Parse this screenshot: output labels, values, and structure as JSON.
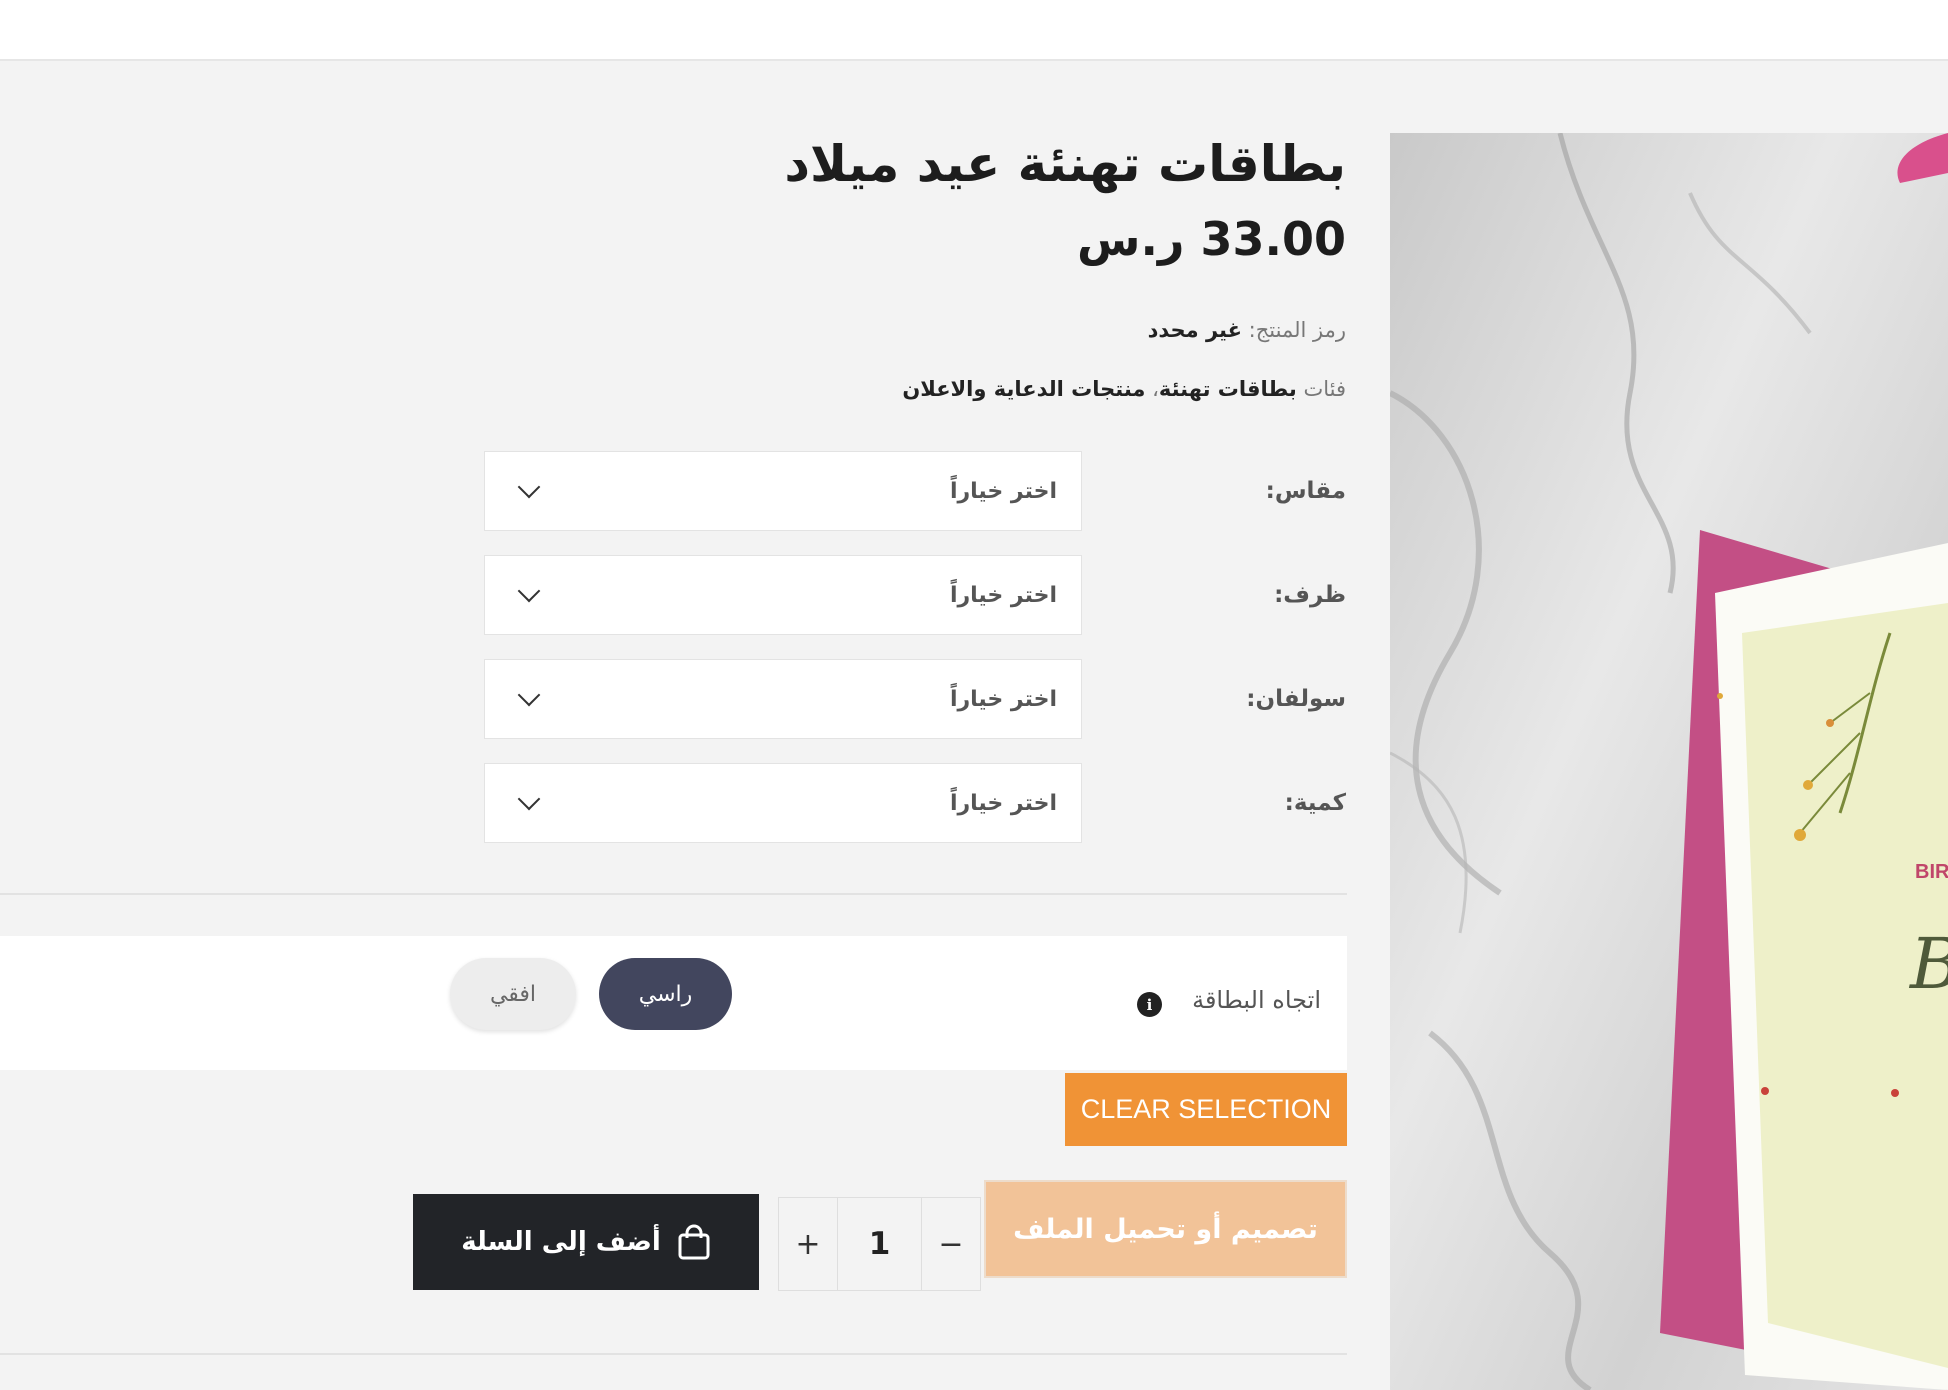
{
  "product": {
    "title": "بطاقات تهنئة عيد ميلاد",
    "price": "33.00 ر.س",
    "sku_label": "رمز المنتج:",
    "sku_value": "غير محدد",
    "categories_label": "فئات",
    "categories": [
      "بطاقات تهنئة",
      "منتجات الدعاية والاعلان"
    ],
    "categories_separator": "،",
    "image_text": "BIRTHDAY"
  },
  "variations": [
    {
      "label": "مقاس:",
      "value": "اختر خياراً"
    },
    {
      "label": "ظرف:",
      "value": "اختر خياراً"
    },
    {
      "label": "سولفان:",
      "value": "اختر خياراً"
    },
    {
      "label": "كمية:",
      "value": "اختر خياراً"
    }
  ],
  "orientation": {
    "label": "اتجاه البطاقة",
    "info_icon": "info-icon",
    "options": [
      "راسي",
      "افقي"
    ],
    "selected": "راسي"
  },
  "actions": {
    "clear_selection": "CLEAR SELECTION",
    "design_upload": "تصميم أو تحميل الملف",
    "add_to_cart": "أضف إلى السلة",
    "cart_icon": "shopping-bag-icon",
    "quantity": "1",
    "decrease": "−",
    "increase": "+"
  },
  "colors": {
    "accent_orange": "#f09336",
    "design_button": "#f2c398",
    "active_pill": "#42465e",
    "cart_button": "#222428"
  }
}
